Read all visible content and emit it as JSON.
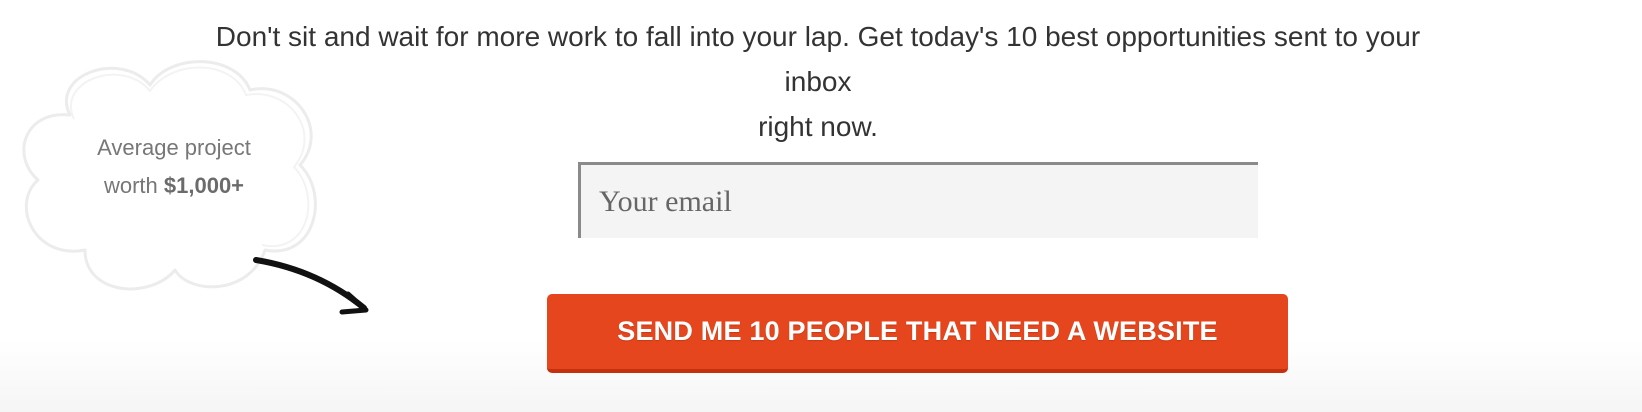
{
  "headline": {
    "line1": "Don't sit and wait for more work to fall into your lap. Get today's 10 best opportunities sent to your inbox",
    "line2": "right now."
  },
  "callout": {
    "line1": "Average project",
    "line2_prefix": "worth ",
    "line2_amount": "$1,000+"
  },
  "form": {
    "email_placeholder": "Your email",
    "email_value": "",
    "submit_label": "SEND ME 10 PEOPLE THAT NEED A WEBSITE"
  },
  "colors": {
    "cta_background": "#e5461d",
    "cta_text": "#ffffff",
    "headline_text": "#333333",
    "input_background": "#f4f4f4"
  },
  "icons": [
    "cloud-doodle-icon",
    "curved-arrow-icon"
  ]
}
